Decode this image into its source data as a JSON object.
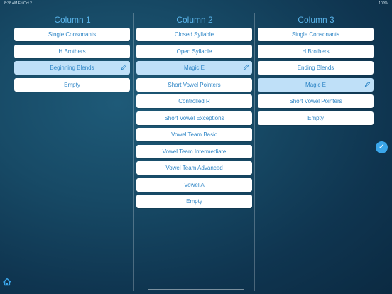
{
  "status": {
    "time": "8:38 AM",
    "date": "Fri Oct 2",
    "battery": "100%"
  },
  "columns": [
    {
      "title": "Column 1",
      "items": [
        "Single Consonants",
        "H Brothers",
        "Beginning Blends",
        "Empty"
      ],
      "selected_index": 2
    },
    {
      "title": "Column 2",
      "items": [
        "Closed Syllable",
        "Open Syllable",
        "Magic E",
        "Short Vowel Pointers",
        "Controlled R",
        "Short Vowel Exceptions",
        "Vowel Team Basic",
        "Vowel Team Intermediate",
        "Vowel Team Advanced",
        "Vowel A",
        "Empty"
      ],
      "selected_index": 2
    },
    {
      "title": "Column 3",
      "items": [
        "Single Consonants",
        "H Brothers",
        "Ending Blends",
        "Magic E",
        "Short Vowel Pointers",
        "Empty"
      ],
      "selected_index": 3
    }
  ],
  "icons": {
    "edit": "pencil-icon",
    "confirm": "checkmark-icon",
    "home": "home-icon"
  },
  "colors": {
    "accent": "#3aa6ea",
    "button_text": "#2f86c6",
    "selected_bg": "#bfe0f8"
  }
}
